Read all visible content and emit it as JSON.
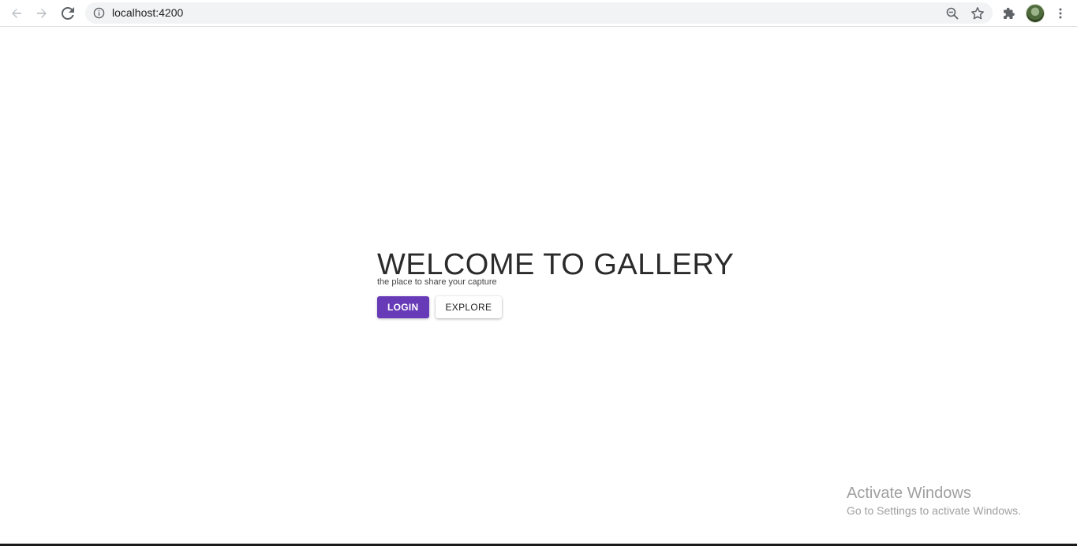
{
  "browser": {
    "url": "localhost:4200",
    "icons": {
      "back": "arrow-left-icon",
      "forward": "arrow-right-icon",
      "reload": "reload-icon",
      "info": "info-icon",
      "zoom": "zoom-out-icon",
      "bookmark": "star-icon",
      "extensions": "puzzle-icon",
      "menu": "kebab-menu-icon"
    }
  },
  "hero": {
    "title": "WELCOME TO GALLERY",
    "subtitle": "the place to share your capture",
    "login_label": "LOGIN",
    "explore_label": "EXPLORE"
  },
  "watermark": {
    "title": "Activate Windows",
    "subtitle": "Go to Settings to activate Windows."
  },
  "colors": {
    "primary": "#673ab7",
    "title_text": "#2b2b2b"
  }
}
